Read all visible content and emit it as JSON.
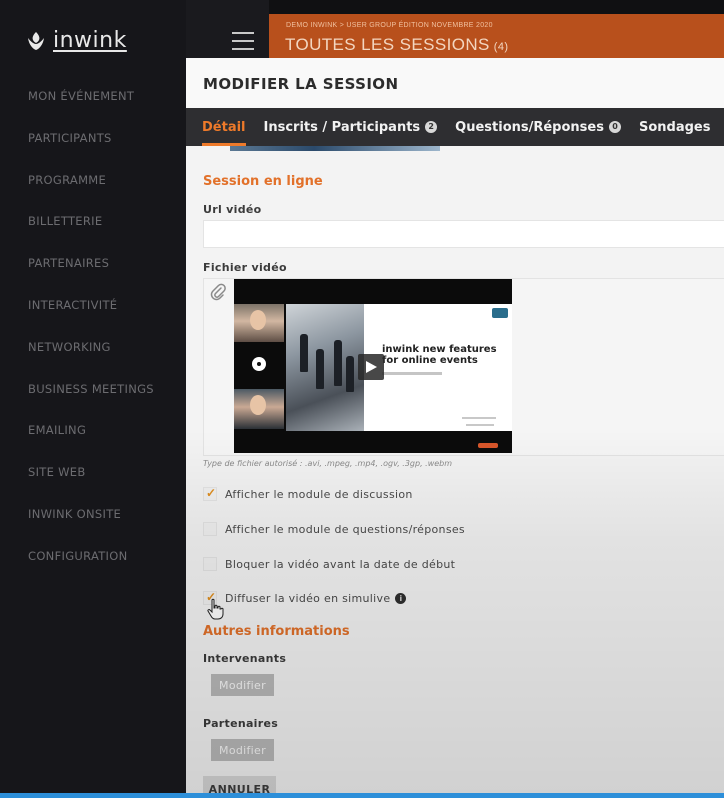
{
  "app": {
    "logo_text": "inwink",
    "icons": {
      "logo": "inwink-leaf-icon",
      "menu": "hamburger-icon"
    }
  },
  "sidebar": {
    "items": [
      {
        "label": "MON ÉVÉNEMENT"
      },
      {
        "label": "PARTICIPANTS"
      },
      {
        "label": "PROGRAMME"
      },
      {
        "label": "BILLETTERIE"
      },
      {
        "label": "PARTENAIRES"
      },
      {
        "label": "INTERACTIVITÉ"
      },
      {
        "label": "NETWORKING"
      },
      {
        "label": "BUSINESS MEETINGS"
      },
      {
        "label": "EMAILING"
      },
      {
        "label": "SITE WEB"
      },
      {
        "label": "INWINK ONSITE"
      },
      {
        "label": "CONFIGURATION"
      }
    ]
  },
  "page_header": {
    "breadcrumb": "DEMO INWINK > USER GROUP ÉDITION NOVEMBRE 2020",
    "title": "TOUTES LES SESSIONS",
    "count": "(4)",
    "color": "#b8501c"
  },
  "modal": {
    "title": "MODIFIER LA SESSION",
    "accent_color": "#ee7a2a",
    "tabs": [
      {
        "label": "Détail",
        "active": true
      },
      {
        "label": "Inscrits / Participants",
        "badge": "2"
      },
      {
        "label": "Questions/Réponses",
        "badge": "0"
      },
      {
        "label": "Sondages"
      }
    ],
    "online": {
      "section_title": "Session en ligne",
      "url_label": "Url vidéo",
      "url_value": "",
      "file_label": "Fichier vidéo",
      "video_title_line1": "inwink new features",
      "video_title_line2": "for online events",
      "file_hint": "Type de fichier autorisé : .avi, .mpeg, .mp4, .ogv, .3gp, .webm",
      "icons": {
        "attach": "paperclip-icon",
        "play": "play-icon"
      }
    },
    "checkboxes": [
      {
        "label": "Afficher le module de discussion",
        "checked": true
      },
      {
        "label": "Afficher le module de questions/réponses",
        "checked": false
      },
      {
        "label": "Bloquer la vidéo avant la date de début",
        "checked": false
      },
      {
        "label": "Diffuser la vidéo en simulive",
        "checked": true,
        "info": true
      }
    ],
    "other": {
      "section_title": "Autres informations",
      "speakers_label": "Intervenants",
      "speakers_button": "Modifier",
      "partners_label": "Partenaires",
      "partners_button": "Modifier"
    },
    "cancel_button": "ANNULER"
  }
}
